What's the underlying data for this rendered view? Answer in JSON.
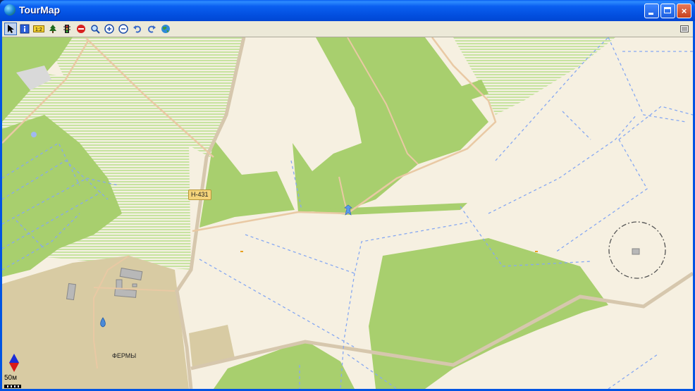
{
  "window": {
    "title": "TourMap",
    "controls": {
      "minimize": "minimize",
      "maximize": "maximize",
      "close": "×"
    }
  },
  "toolbar": {
    "tools": [
      {
        "name": "pointer-tool",
        "icon": "arrow-cursor-icon"
      },
      {
        "name": "info-tool",
        "icon": "info-icon"
      },
      {
        "name": "measure-tool",
        "icon": "ruler-icon",
        "text": "1:2"
      },
      {
        "name": "tree-tool",
        "icon": "tree-icon"
      },
      {
        "name": "traffic-tool",
        "icon": "traffic-light-icon"
      },
      {
        "name": "stop-tool",
        "icon": "no-entry-icon"
      },
      {
        "name": "search-tool",
        "icon": "magnifier-icon"
      },
      {
        "name": "zoom-in-tool",
        "icon": "zoom-in-icon"
      },
      {
        "name": "zoom-out-tool",
        "icon": "zoom-out-icon"
      },
      {
        "name": "undo-tool",
        "icon": "undo-icon"
      },
      {
        "name": "redo-tool",
        "icon": "redo-icon"
      },
      {
        "name": "globe-tool",
        "icon": "globe-icon"
      }
    ],
    "right_tool": {
      "name": "list-tool",
      "icon": "list-icon"
    }
  },
  "map": {
    "road_label": "Н-431",
    "place_label": "ФЕРМЫ",
    "scale": "50м",
    "colors": {
      "background": "#f6f0e1",
      "forest": "#a8cf6e",
      "stripe": "#c7e3a0",
      "road": "#e9c9a4",
      "major_road": "#d6c7ad",
      "farm_area": "#d8cba3",
      "boundary": "#86a8f2"
    }
  }
}
